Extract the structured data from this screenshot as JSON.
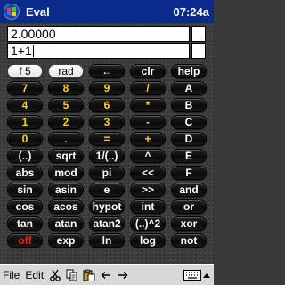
{
  "titlebar": {
    "app_title": "Eval",
    "clock": "07:24a"
  },
  "display": {
    "result": "2.00000",
    "expression": "1+1"
  },
  "keypad": [
    {
      "label": "f  5",
      "style": "light",
      "name": "f-key"
    },
    {
      "label": "rad",
      "style": "light",
      "name": "rad-key"
    },
    {
      "label": "←",
      "style": "dark",
      "name": "backspace-key"
    },
    {
      "label": "clr",
      "style": "dark",
      "name": "clr-key"
    },
    {
      "label": "help",
      "style": "dark",
      "name": "help-key"
    },
    {
      "label": "7",
      "style": "num",
      "name": "key-7"
    },
    {
      "label": "8",
      "style": "num",
      "name": "key-8"
    },
    {
      "label": "9",
      "style": "num",
      "name": "key-9"
    },
    {
      "label": "/",
      "style": "num",
      "name": "divide-key"
    },
    {
      "label": "A",
      "style": "dark",
      "name": "key-a"
    },
    {
      "label": "4",
      "style": "num",
      "name": "key-4"
    },
    {
      "label": "5",
      "style": "num",
      "name": "key-5"
    },
    {
      "label": "6",
      "style": "num",
      "name": "key-6"
    },
    {
      "label": "*",
      "style": "num",
      "name": "multiply-key"
    },
    {
      "label": "B",
      "style": "dark",
      "name": "key-b"
    },
    {
      "label": "1",
      "style": "num",
      "name": "key-1"
    },
    {
      "label": "2",
      "style": "num",
      "name": "key-2"
    },
    {
      "label": "3",
      "style": "num",
      "name": "key-3"
    },
    {
      "label": "-",
      "style": "num",
      "name": "minus-key"
    },
    {
      "label": "C",
      "style": "dark",
      "name": "key-c"
    },
    {
      "label": "0",
      "style": "num",
      "name": "key-0"
    },
    {
      "label": ".",
      "style": "num",
      "name": "decimal-key"
    },
    {
      "label": "=",
      "style": "num",
      "name": "equals-key"
    },
    {
      "label": "+",
      "style": "num",
      "name": "plus-key"
    },
    {
      "label": "D",
      "style": "dark",
      "name": "key-d"
    },
    {
      "label": "(..)",
      "style": "dark",
      "name": "parens-key"
    },
    {
      "label": "sqrt",
      "style": "dark",
      "name": "sqrt-key"
    },
    {
      "label": "1/(..)",
      "style": "dark",
      "name": "reciprocal-key"
    },
    {
      "label": "^",
      "style": "dark",
      "name": "power-key"
    },
    {
      "label": "E",
      "style": "dark",
      "name": "key-e"
    },
    {
      "label": "abs",
      "style": "dark",
      "name": "abs-key"
    },
    {
      "label": "mod",
      "style": "dark",
      "name": "mod-key"
    },
    {
      "label": "pi",
      "style": "dark",
      "name": "pi-key"
    },
    {
      "label": "<<",
      "style": "dark",
      "name": "shift-left-key"
    },
    {
      "label": "F",
      "style": "dark",
      "name": "key-f"
    },
    {
      "label": "sin",
      "style": "dark",
      "name": "sin-key"
    },
    {
      "label": "asin",
      "style": "dark",
      "name": "asin-key"
    },
    {
      "label": "e",
      "style": "dark",
      "name": "e-key"
    },
    {
      "label": ">>",
      "style": "dark",
      "name": "shift-right-key"
    },
    {
      "label": "and",
      "style": "dark",
      "name": "and-key"
    },
    {
      "label": "cos",
      "style": "dark",
      "name": "cos-key"
    },
    {
      "label": "acos",
      "style": "dark",
      "name": "acos-key"
    },
    {
      "label": "hypot",
      "style": "dark",
      "name": "hypot-key"
    },
    {
      "label": "int",
      "style": "dark",
      "name": "int-key"
    },
    {
      "label": "or",
      "style": "dark",
      "name": "or-key"
    },
    {
      "label": "tan",
      "style": "dark",
      "name": "tan-key"
    },
    {
      "label": "atan",
      "style": "dark",
      "name": "atan-key"
    },
    {
      "label": "atan2",
      "style": "dark",
      "name": "atan2-key"
    },
    {
      "label": "(..)^2",
      "style": "dark",
      "name": "square-key"
    },
    {
      "label": "xor",
      "style": "dark",
      "name": "xor-key"
    },
    {
      "label": "off",
      "style": "red",
      "name": "off-key"
    },
    {
      "label": "exp",
      "style": "dark",
      "name": "exp-key"
    },
    {
      "label": "ln",
      "style": "dark",
      "name": "ln-key"
    },
    {
      "label": "log",
      "style": "dark",
      "name": "log-key"
    },
    {
      "label": "not",
      "style": "dark",
      "name": "not-key"
    }
  ],
  "menubar": {
    "file": "File",
    "edit": "Edit"
  },
  "colors": {
    "titlebar": "#0a2a8c",
    "digit_text": "#ffd200",
    "off_text": "#ff1a1a",
    "key_background": "#111111"
  }
}
